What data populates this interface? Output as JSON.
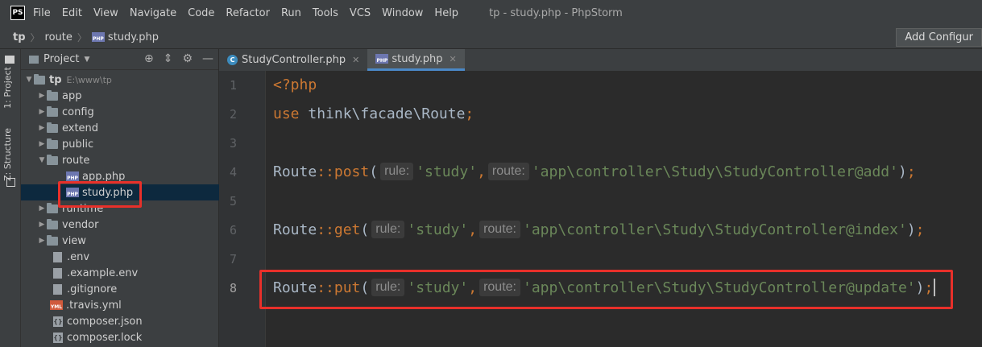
{
  "window": {
    "title": "tp - study.php - PhpStorm",
    "logo": "PS"
  },
  "menu": [
    "File",
    "Edit",
    "View",
    "Navigate",
    "Code",
    "Refactor",
    "Run",
    "Tools",
    "VCS",
    "Window",
    "Help"
  ],
  "breadcrumb": [
    "tp",
    "route",
    "study.php"
  ],
  "run_config": {
    "label": "Add Configur"
  },
  "left_tool_tabs": {
    "project": "1: Project",
    "structure": "Z: Structure"
  },
  "project_panel": {
    "title": "Project",
    "root": {
      "name": "tp",
      "path": "E:\\www\\tp"
    },
    "items": [
      {
        "name": "app",
        "type": "folder"
      },
      {
        "name": "config",
        "type": "folder"
      },
      {
        "name": "extend",
        "type": "folder"
      },
      {
        "name": "public",
        "type": "folder"
      },
      {
        "name": "route",
        "type": "folder"
      },
      {
        "name": "app.php",
        "type": "php"
      },
      {
        "name": "study.php",
        "type": "php"
      },
      {
        "name": "runtime",
        "type": "folder"
      },
      {
        "name": "vendor",
        "type": "folder"
      },
      {
        "name": "view",
        "type": "folder"
      },
      {
        "name": ".env",
        "type": "file"
      },
      {
        "name": ".example.env",
        "type": "file"
      },
      {
        "name": ".gitignore",
        "type": "file"
      },
      {
        "name": ".travis.yml",
        "type": "yml"
      },
      {
        "name": "composer.json",
        "type": "json"
      },
      {
        "name": "composer.lock",
        "type": "json"
      }
    ]
  },
  "editor_tabs": [
    {
      "label": "StudyController.php",
      "icon": "class-icon"
    },
    {
      "label": "study.php",
      "icon": "php-file-icon"
    }
  ],
  "code": {
    "line_numbers": [
      "1",
      "2",
      "3",
      "4",
      "5",
      "6",
      "7",
      "8"
    ],
    "l1": "<?php",
    "l2_kw": "use",
    "l2_txt": " think\\facade\\Route",
    "semi": ";",
    "route_class": "Route",
    "colons": "::",
    "post": "post",
    "get": "get",
    "put": "put",
    "open_paren": "(",
    "close_paren": ")",
    "comma": ",",
    "hint_rule": "rule:",
    "hint_route": "route:",
    "rule_value": "'study'",
    "l4_route": "'app\\controller\\Study\\StudyController@add'",
    "l6_route": "'app\\controller\\Study\\StudyController@index'",
    "l8_route": "'app\\controller\\Study\\StudyController@update'"
  },
  "colors": {
    "highlight_box": "#e8302a",
    "keyword": "#cc7832",
    "string": "#6a8759"
  }
}
